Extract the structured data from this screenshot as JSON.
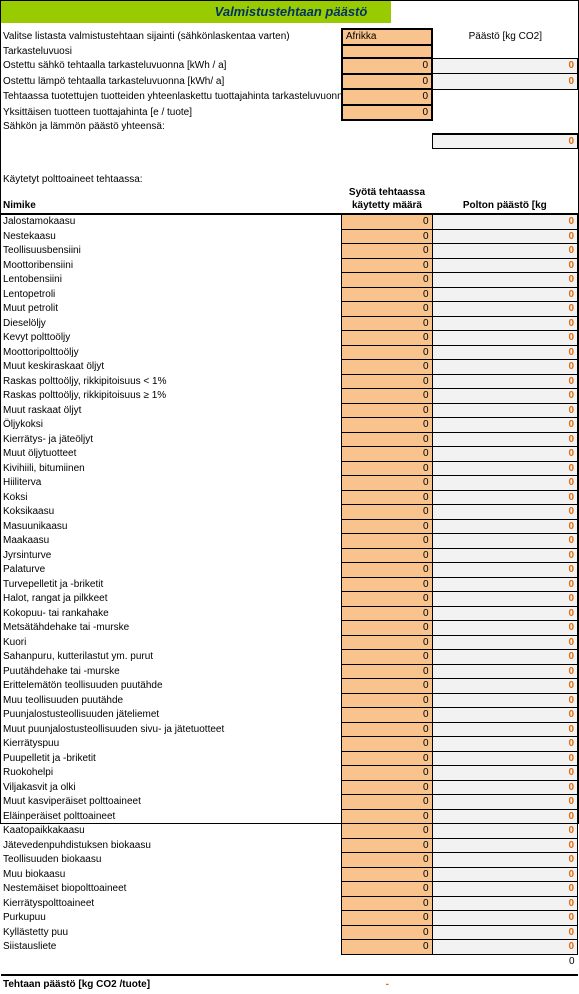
{
  "title": "Valmistustehtaan päästö",
  "top": {
    "rows": [
      {
        "label": "Valitse listasta valmistustehtaan sijainti (sähkönlaskentaa varten)",
        "val": "Afrikka",
        "valType": "text",
        "bold": true,
        "emission_header": "Päästö [kg CO2]"
      },
      {
        "label": "Tarkasteluvuosi",
        "val": "",
        "valType": "blank"
      },
      {
        "label": "Ostettu sähkö tehtaalla tarkasteluvuonna [kWh / a]",
        "val": "0",
        "valType": "num",
        "emission": "0"
      },
      {
        "label": "Ostettu lämpö tehtaalla tarkasteluvuonna [kWh/ a]",
        "val": "0",
        "valType": "num",
        "emission": "0"
      },
      {
        "label": "Tehtaassa tuotettujen tuotteiden yhteenlaskettu tuottajahinta tarkasteluvuonna [e",
        "val": "0",
        "valType": "num"
      },
      {
        "label": "Yksittäisen tuotteen tuottajahinta [e / tuote]",
        "val": "0",
        "valType": "num"
      }
    ],
    "sum_label": "Sähkön ja lämmön päästö yhteensä:",
    "sum_val": "0"
  },
  "fuels": {
    "intro": "Käytetyt polttoaineet tehtaassa:",
    "headers": {
      "name": "Nimike",
      "qty": "Syötä tehtaassa käytetty määrä",
      "emit": "Polton päästö [kg"
    },
    "rows": [
      "Jalostamokaasu",
      "Nestekaasu",
      "Teollisuusbensiini",
      "Moottoribensiini",
      "Lentobensiini",
      "Lentopetroli",
      "Muut petrolit",
      "Dieselöljy",
      "Kevyt polttoöljy",
      "Moottoripolttoöljy",
      "Muut keskiraskaat öljyt",
      "Raskas polttoöljy, rikkipitoisuus < 1%",
      "Raskas polttoöljy, rikkipitoisuus ≥ 1%",
      "Muut raskaat öljyt",
      "Öljykoksi",
      "Kierrätys- ja jäteöljyt",
      "Muut öljytuotteet",
      "Kivihiili, bitumiinen",
      "Hiiliterva",
      "Koksi",
      "Koksikaasu",
      "Masuunikaasu",
      "Maakaasu",
      "Jyrsinturve",
      "Palaturve",
      "Turvepelletit ja -briketit",
      "Halot, rangat ja pilkkeet",
      "Kokopuu- tai rankahake",
      "Metsätähdehake tai -murske",
      "Kuori",
      "Sahanpuru, kutterilastut ym. purut",
      "Puutähdehake tai -murske",
      "Erittelemätön teollisuuden puutähde",
      "Muu teollisuuden puutähde",
      "Puunjalostusteollisuuden jäteliemet",
      "Muut puunjalostusteollisuuden sivu- ja jätetuotteet",
      "Kierrätyspuu",
      "Puupelletit ja -briketit",
      "Ruokohelpi",
      "Viljakasvit ja olki",
      "Muut kasviperäiset polttoaineet",
      "Eläinperäiset polttoaineet",
      "Kaatopaikkakaasu",
      "Jätevedenpuhdistuksen biokaasu",
      "Teollisuuden biokaasu",
      "Muu biokaasu",
      "Nestemäiset biopolttoaineet",
      "Kierrätyspolttoaineet",
      "Purkupuu",
      "Kyllästetty puu",
      "Siistausliete"
    ],
    "qty_val": "0",
    "emit_val": "0",
    "tail_val": "0"
  },
  "bottom": {
    "label": "Tehtaan päästö [kg CO2 /tuote]",
    "val": "-"
  }
}
